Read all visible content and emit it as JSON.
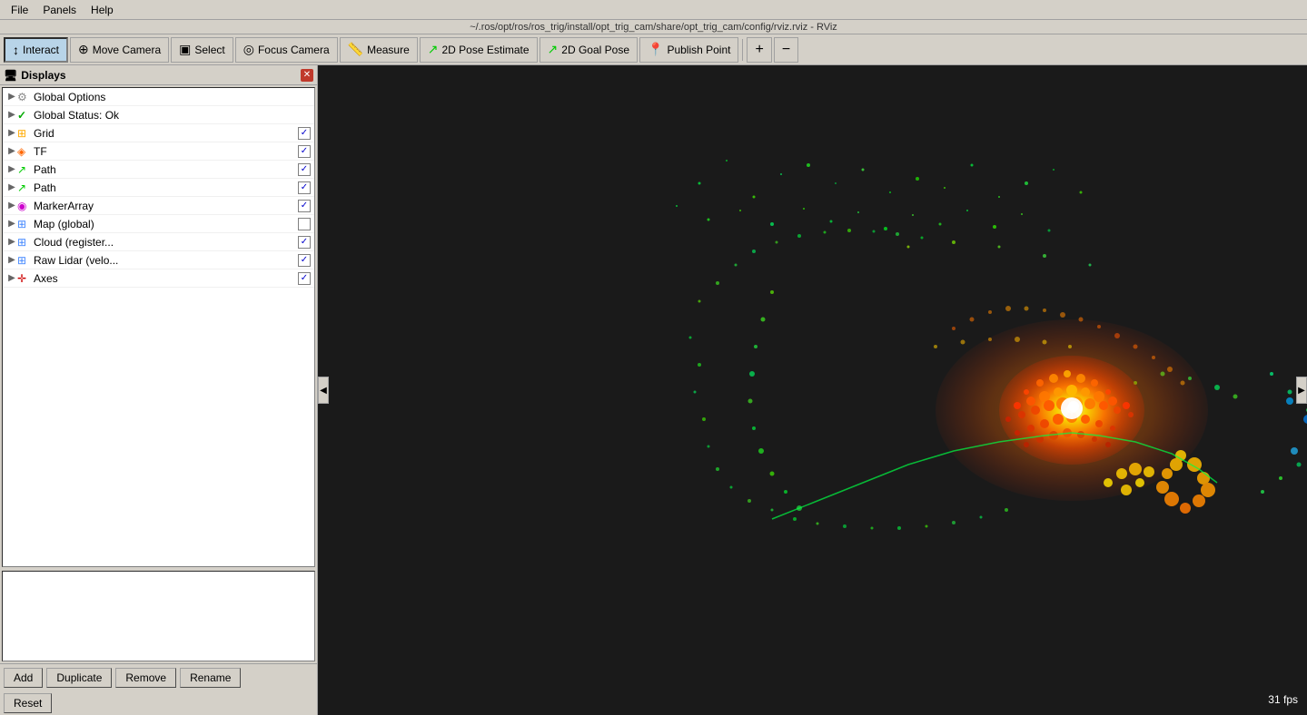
{
  "titlebar": {
    "text": "~/.ros/opt/ros/ros_trig/install/opt_trig_cam/share/opt_trig_cam/config/rviz.rviz - RViz"
  },
  "menubar": {
    "items": [
      "File",
      "Panels",
      "Help"
    ]
  },
  "toolbar": {
    "buttons": [
      {
        "id": "interact",
        "label": "Interact",
        "icon": "↕",
        "active": true
      },
      {
        "id": "move-camera",
        "label": "Move Camera",
        "icon": "⊕"
      },
      {
        "id": "select",
        "label": "Select",
        "icon": "▣"
      },
      {
        "id": "focus-camera",
        "label": "Focus Camera",
        "icon": "◎"
      },
      {
        "id": "measure",
        "label": "Measure",
        "icon": "📏"
      },
      {
        "id": "2d-pose",
        "label": "2D Pose Estimate",
        "icon": "↗"
      },
      {
        "id": "2d-goal",
        "label": "2D Goal Pose",
        "icon": "↗"
      },
      {
        "id": "publish-point",
        "label": "Publish Point",
        "icon": "📍"
      }
    ],
    "zoom_in": "+",
    "zoom_out": "−"
  },
  "displays_panel": {
    "title": "Displays",
    "items": [
      {
        "id": "global-options",
        "label": "Global Options",
        "icon": "⚙",
        "color": "#888",
        "indent": 0,
        "has_expand": true,
        "checked": null
      },
      {
        "id": "global-status",
        "label": "Global Status: Ok",
        "icon": "✓",
        "color": "#00aa00",
        "indent": 0,
        "has_expand": true,
        "checked": null
      },
      {
        "id": "grid",
        "label": "Grid",
        "icon": "⊞",
        "color": "#ffaa00",
        "indent": 0,
        "has_expand": true,
        "checked": true
      },
      {
        "id": "tf",
        "label": "TF",
        "icon": "◈",
        "color": "#ff6600",
        "indent": 0,
        "has_expand": true,
        "checked": true
      },
      {
        "id": "path1",
        "label": "Path",
        "icon": "↗",
        "color": "#00cc00",
        "indent": 0,
        "has_expand": true,
        "checked": true
      },
      {
        "id": "path2",
        "label": "Path",
        "icon": "↗",
        "color": "#00cc00",
        "indent": 0,
        "has_expand": true,
        "checked": true
      },
      {
        "id": "marker-array",
        "label": "MarkerArray",
        "icon": "◉",
        "color": "#cc00cc",
        "indent": 0,
        "has_expand": true,
        "checked": true
      },
      {
        "id": "map-global",
        "label": "Map (global)",
        "icon": "⊞",
        "color": "#4488ff",
        "indent": 0,
        "has_expand": true,
        "checked": false
      },
      {
        "id": "cloud-register",
        "label": "Cloud (register...",
        "icon": "⊞",
        "color": "#4488ff",
        "indent": 0,
        "has_expand": true,
        "checked": true
      },
      {
        "id": "raw-lidar",
        "label": "Raw Lidar (velo...",
        "icon": "⊞",
        "color": "#4488ff",
        "indent": 0,
        "has_expand": true,
        "checked": true
      },
      {
        "id": "axes",
        "label": "Axes",
        "icon": "✛",
        "color": "#cc0000",
        "indent": 0,
        "has_expand": true,
        "checked": true
      }
    ],
    "bottom_buttons": {
      "add": "Add",
      "duplicate": "Duplicate",
      "remove": "Remove",
      "rename": "Rename",
      "reset": "Reset"
    }
  },
  "viewport": {
    "fps": "31 fps"
  }
}
